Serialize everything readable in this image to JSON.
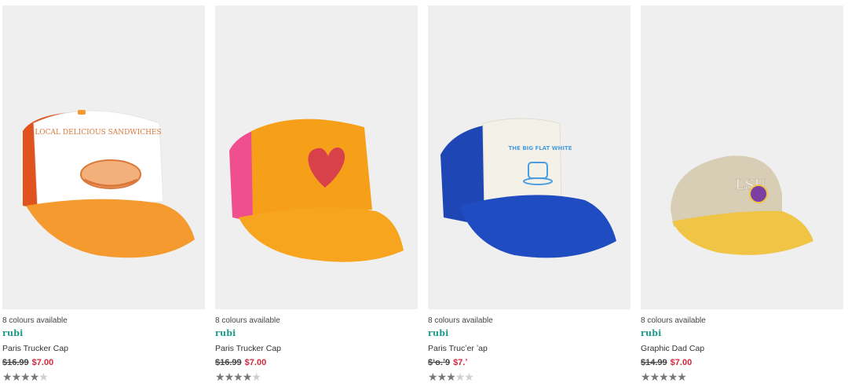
{
  "products": [
    {
      "colours_text": "8 colours available",
      "brand": "rubi",
      "name": "Paris Trucker Cap",
      "was_price": "$16.99",
      "price": "$7.00",
      "rating": 4,
      "image_label": "LOCAL DELICIOUS SANDWICHES",
      "colors": {
        "mesh": "#e0521e",
        "front": "#ffffff",
        "brim": "#f59a2e",
        "print": "#d9783a"
      }
    },
    {
      "colours_text": "8 colours available",
      "brand": "rubi",
      "name": "Paris Trucker Cap",
      "was_price": "$16.99",
      "price": "$7.00",
      "rating": 4,
      "image_label": "",
      "colors": {
        "mesh": "#ef4f8f",
        "front": "#f6a019",
        "brim": "#f7a51e",
        "print": "#d8404a"
      }
    },
    {
      "colours_text": "8 colours available",
      "brand": "rubi",
      "name": "Paris Trucʼer ʼap",
      "was_price": "$ʻo.ʼ9",
      "price": "$7.ʼ",
      "rating": 3,
      "image_label": "THE BIG FLAT WHITE",
      "colors": {
        "mesh": "#1e47b5",
        "front": "#f4f1e8",
        "brim": "#1f4cc0",
        "print": "#4a9ee0"
      }
    },
    {
      "colours_text": "8 colours available",
      "brand": "rubi",
      "name": "Graphic Dad Cap",
      "was_price": "$14.99",
      "price": "$7.00",
      "rating": 4.5,
      "image_label": "LSU",
      "colors": {
        "mesh": "#d8cdb5",
        "front": "#d8cdb5",
        "brim": "#f0c445",
        "print": "#ffffff"
      }
    }
  ]
}
